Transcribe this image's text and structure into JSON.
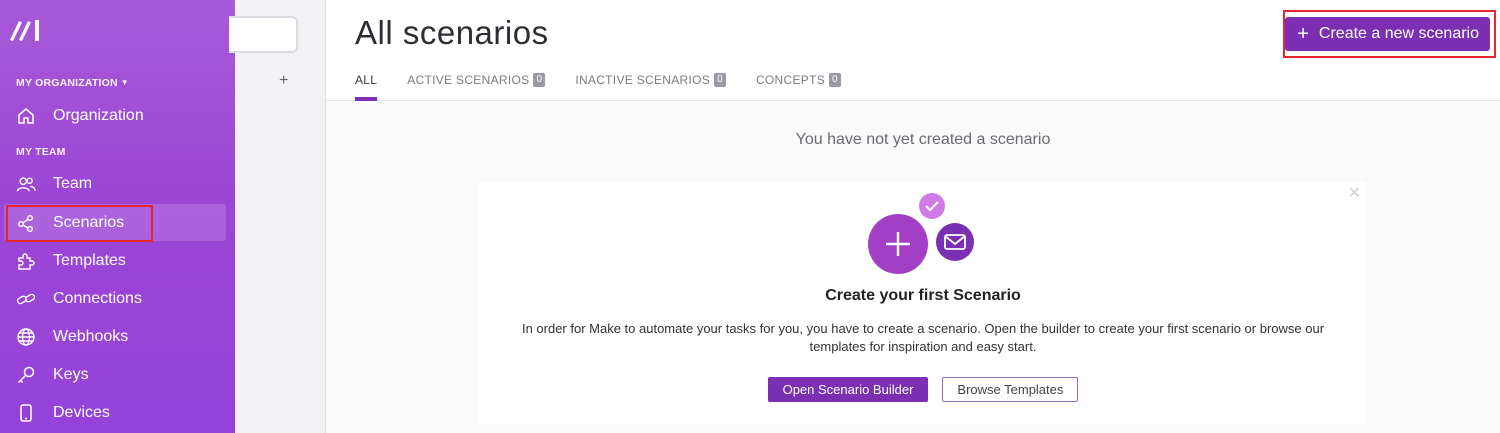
{
  "sidebar": {
    "org_section": "MY ORGANIZATION",
    "team_section": "MY TEAM",
    "items": [
      {
        "label": "Organization",
        "icon": "home-icon"
      },
      {
        "label": "Team",
        "icon": "users-icon"
      },
      {
        "label": "Scenarios",
        "icon": "share-icon",
        "active": true
      },
      {
        "label": "Templates",
        "icon": "puzzle-icon"
      },
      {
        "label": "Connections",
        "icon": "link-icon"
      },
      {
        "label": "Webhooks",
        "icon": "globe-icon"
      },
      {
        "label": "Keys",
        "icon": "key-icon"
      },
      {
        "label": "Devices",
        "icon": "phone-icon"
      }
    ]
  },
  "header": {
    "title": "All scenarios",
    "create_button": "Create a new scenario"
  },
  "tabs": [
    {
      "label": "ALL",
      "active": true
    },
    {
      "label": "ACTIVE SCENARIOS",
      "count": "0"
    },
    {
      "label": "INACTIVE SCENARIOS",
      "count": "0"
    },
    {
      "label": "CONCEPTS",
      "count": "0"
    }
  ],
  "main": {
    "empty_message": "You have not yet created a scenario"
  },
  "card": {
    "title": "Create your first Scenario",
    "text": "In order for Make to automate your tasks for you, you have to create a scenario. Open the builder to create your first scenario or browse our templates for inspiration and easy start.",
    "primary_button": "Open Scenario Builder",
    "secondary_button": "Browse Templates",
    "close_icon": "close-icon"
  },
  "colors": {
    "brand": "#7b2fb3",
    "sidebar": "#9c46d6",
    "highlight": "#e5262e"
  }
}
